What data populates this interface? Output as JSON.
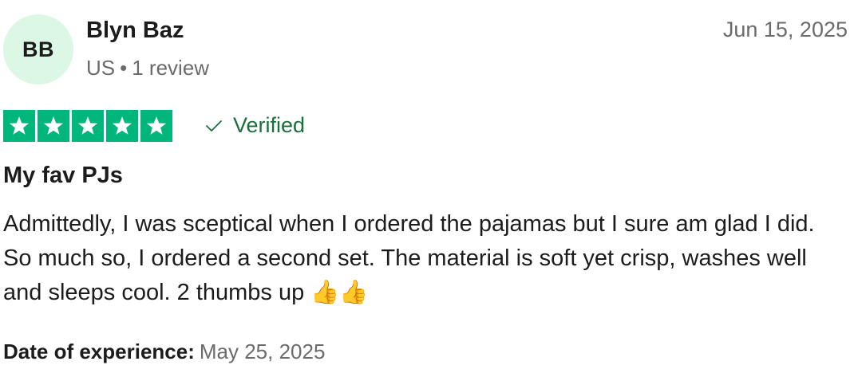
{
  "reviewer": {
    "initials": "BB",
    "name": "Blyn Baz",
    "country": "US",
    "separator": "•",
    "review_count": "1 review",
    "avatar_color": "#dcf8e4"
  },
  "review": {
    "date": "Jun 15, 2025",
    "rating": 5,
    "rating_max": 5,
    "star_color": "#00b67a",
    "verified_label": "Verified",
    "verified_color": "#1b6f3b",
    "title": "My fav PJs",
    "body": "Admittedly, I was sceptical when I ordered the pajamas but I sure am glad I did. So much so, I ordered a second set. The material is soft yet crisp, washes well and sleeps cool. 2 thumbs up 👍👍",
    "experience_label": "Date of experience:",
    "experience_date": "May 25, 2025"
  },
  "icons": {
    "star": "star-icon",
    "verified": "checkmark-icon"
  }
}
